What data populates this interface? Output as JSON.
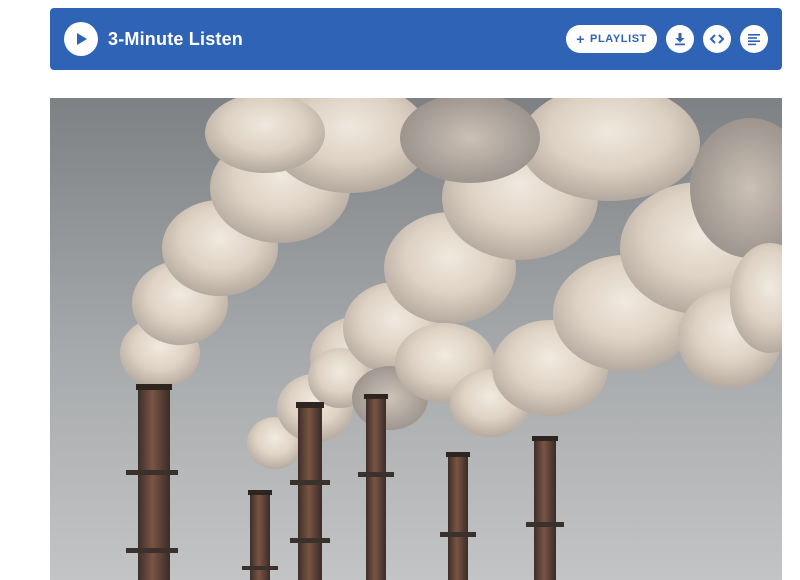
{
  "player": {
    "title": "3-Minute Listen",
    "playlist_label": "PLAYLIST",
    "playlist_icon": "plus-icon",
    "play_icon": "play-icon",
    "download_icon": "download-icon",
    "embed_icon": "embed-code-icon",
    "transcript_icon": "transcript-icon",
    "accent_color": "#2f63b6"
  }
}
